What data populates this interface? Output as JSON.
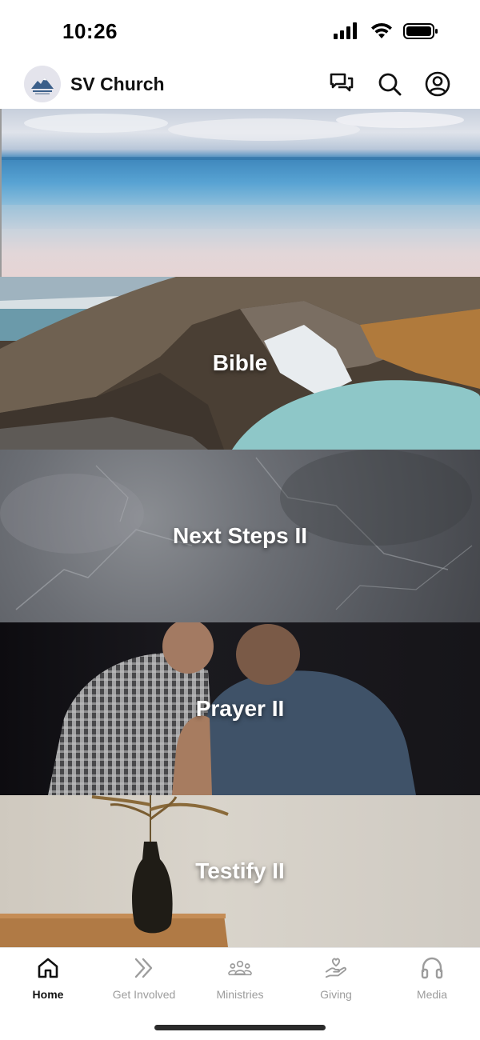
{
  "status_bar": {
    "time": "10:26"
  },
  "header": {
    "app_title": "SV Church"
  },
  "tiles": [
    {
      "label": ""
    },
    {
      "label": "Bible"
    },
    {
      "label": "Next Steps II"
    },
    {
      "label": "Prayer II"
    },
    {
      "label": "Testify II"
    }
  ],
  "tabs": [
    {
      "label": "Home",
      "icon": "home-icon",
      "active": true
    },
    {
      "label": "Get Involved",
      "icon": "double-chevron-icon",
      "active": false
    },
    {
      "label": "Ministries",
      "icon": "people-icon",
      "active": false
    },
    {
      "label": "Giving",
      "icon": "heart-hand-icon",
      "active": false
    },
    {
      "label": "Media",
      "icon": "headphones-icon",
      "active": false
    }
  ],
  "colors": {
    "active_tab": "#111111",
    "inactive_tab": "#9c9c9c",
    "tile_text": "#ffffff"
  }
}
